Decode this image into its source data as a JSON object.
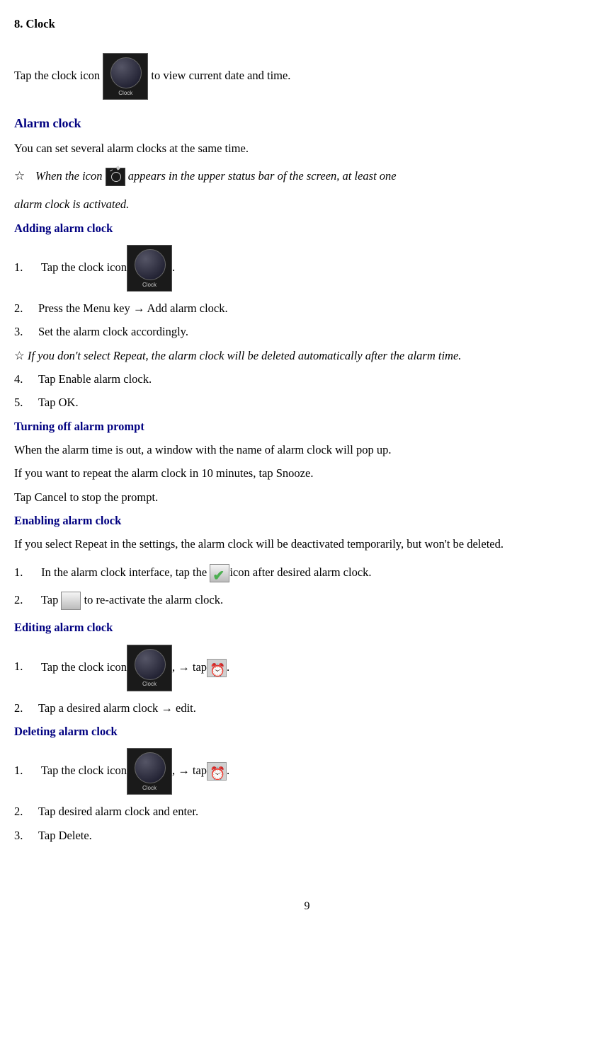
{
  "title": "8. Clock",
  "intro": {
    "part1": "Tap the clock icon",
    "part2": "  to view current date and time."
  },
  "alarm_heading": "Alarm clock",
  "alarm_intro": "You can set several alarm clocks at the same time.",
  "note1": {
    "part1": "When the icon",
    "part2": "appears in the upper status bar of the screen, at least one alarm clock is activated."
  },
  "adding": {
    "heading": "Adding alarm clock",
    "step1": "Tap the clock icon",
    "step2": "Press the Menu key → Add alarm clock.",
    "step3": "Set the alarm clock accordingly.",
    "note": "If you don't select Repeat, the alarm clock will be deleted automatically after the alarm time.",
    "step4": "Tap Enable alarm clock.",
    "step5": "Tap OK."
  },
  "turning_off": {
    "heading": "Turning off alarm prompt",
    "line1": "When the alarm time is out, a window with the name of alarm clock will pop up.",
    "line2": "If you want to repeat the alarm clock in 10 minutes, tap Snooze.",
    "line3": "Tap Cancel to stop the prompt."
  },
  "enabling": {
    "heading": "Enabling alarm clock",
    "line1": "If you select Repeat in the settings, the alarm clock will be deactivated temporarily, but won't be deleted.",
    "step1a": "In the alarm clock interface, tap the ",
    "step1b": "icon after desired alarm clock.",
    "step2a": "Tap ",
    "step2b": "  to re-activate the alarm clock."
  },
  "editing": {
    "heading": "Editing alarm clock",
    "step1a": "Tap the clock icon",
    "step1b": ", → tap",
    "step2": "Tap a desired alarm clock → edit."
  },
  "deleting": {
    "heading": "Deleting alarm clock",
    "step1a": "Tap the clock icon",
    "step1b": ", → tap",
    "step2": "Tap desired alarm clock and enter.",
    "step3": "Tap Delete."
  },
  "clock_icon_label": "Clock",
  "page_number": "9"
}
